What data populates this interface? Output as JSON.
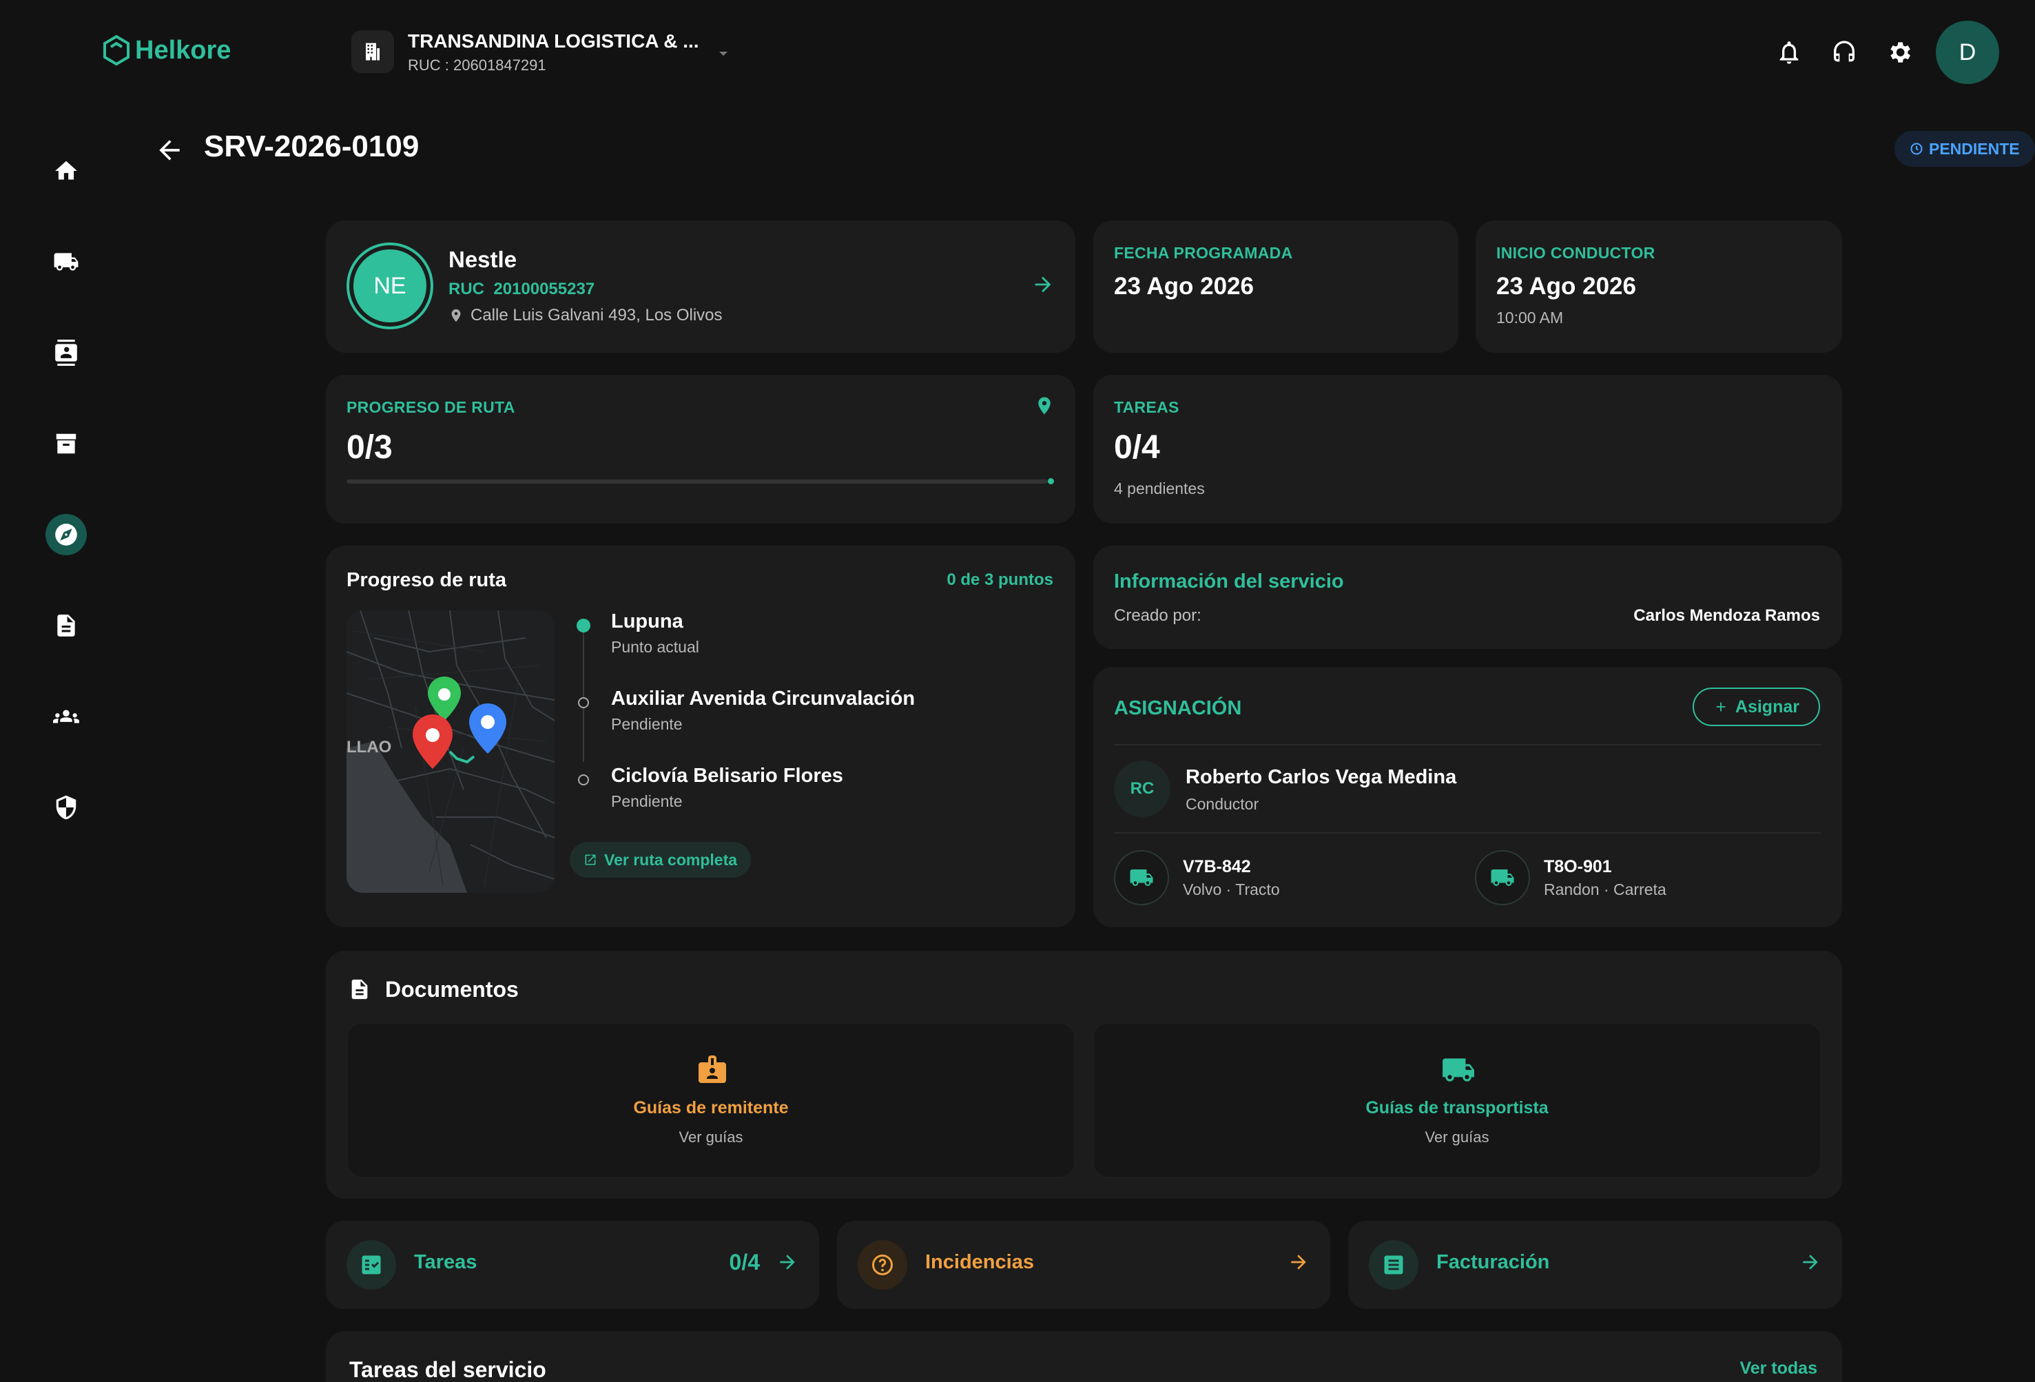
{
  "brand": {
    "name": "Helkore"
  },
  "company": {
    "name": "TRANSANDINA LOGISTICA & ...",
    "ruc": "RUC : 20601847291"
  },
  "user": {
    "initial": "D"
  },
  "sidebar": {
    "items": [
      {
        "icon": "home-icon"
      },
      {
        "icon": "truck-icon"
      },
      {
        "icon": "contacts-icon"
      },
      {
        "icon": "archive-icon"
      },
      {
        "icon": "compass-icon",
        "active": true
      },
      {
        "icon": "document-icon"
      },
      {
        "icon": "group-icon"
      },
      {
        "icon": "shield-icon"
      }
    ]
  },
  "page": {
    "title": "SRV-2026-0109",
    "status": "PENDIENTE"
  },
  "client": {
    "initials": "NE",
    "name": "Nestle",
    "ruc_label": "RUC",
    "ruc": "20100055237",
    "address": "Calle Luis Galvani 493, Los Olivos"
  },
  "scheduled": {
    "label": "FECHA PROGRAMADA",
    "date": "23 Ago 2026"
  },
  "driver_start": {
    "label": "INICIO CONDUCTOR",
    "date": "23 Ago 2026",
    "time": "10:00 AM"
  },
  "route_progress": {
    "label": "PROGRESO DE RUTA",
    "value": "0/3",
    "fraction": 0
  },
  "tasks": {
    "label": "TAREAS",
    "value": "0/4",
    "pending": "4 pendientes"
  },
  "route": {
    "title": "Progreso de ruta",
    "count": "0 de 3 puntos",
    "map_label": "LLAO",
    "stops": [
      {
        "name": "Lupuna",
        "status": "Punto actual"
      },
      {
        "name": "Auxiliar Avenida Circunvalación",
        "status": "Pendiente"
      },
      {
        "name": "Ciclovía Belisario Flores",
        "status": "Pendiente"
      }
    ],
    "link": "Ver ruta completa"
  },
  "service_info": {
    "title": "Información del servicio",
    "created_label": "Creado por:",
    "created_by": "Carlos Mendoza Ramos"
  },
  "assignment": {
    "title": "ASIGNACIÓN",
    "button": "Asignar",
    "driver": {
      "initials": "RC",
      "name": "Roberto Carlos Vega Medina",
      "role": "Conductor"
    },
    "vehicles": [
      {
        "plate": "V7B-842",
        "desc": "Volvo · Tracto"
      },
      {
        "plate": "T8O-901",
        "desc": "Randon · Carreta"
      }
    ]
  },
  "documents": {
    "title": "Documentos",
    "items": [
      {
        "title": "Guías de remitente",
        "subtitle": "Ver guías",
        "color": "#f0a040"
      },
      {
        "title": "Guías de transportista",
        "subtitle": "Ver guías",
        "color": "#2fbf9b"
      }
    ]
  },
  "quick_links": [
    {
      "label": "Tareas",
      "value": "0/4",
      "color": "#2fbf9b"
    },
    {
      "label": "Incidencias",
      "value": "",
      "color": "#f0a040"
    },
    {
      "label": "Facturación",
      "value": "",
      "color": "#2fbf9b"
    }
  ],
  "service_tasks": {
    "title": "Tareas del servicio",
    "link": "Ver todas"
  },
  "colors": {
    "accent": "#2fbf9b",
    "warning": "#f0a040",
    "status_blue": "#4aa3ff",
    "background": "#121212",
    "card": "#1c1c1c"
  }
}
